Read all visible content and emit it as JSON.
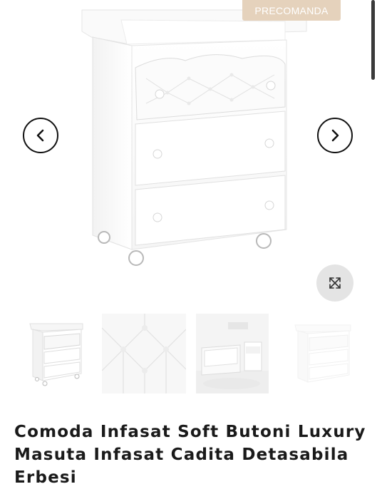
{
  "product": {
    "badge": "PRECOMANDA",
    "title": "Comoda Infasat Soft Butoni Luxury Masuta Infasat Cadita Detasabila Erbesi"
  },
  "gallery": {
    "prev_icon": "chevron-left-icon",
    "next_icon": "chevron-right-icon",
    "zoom_icon": "expand-icon",
    "thumbnails": [
      {
        "name": "thumbnail-front"
      },
      {
        "name": "thumbnail-tufted-detail"
      },
      {
        "name": "thumbnail-room"
      },
      {
        "name": "thumbnail-faded"
      }
    ]
  },
  "colors": {
    "badge_bg": "#e5d2bc",
    "badge_text": "#ffffff",
    "title_text": "#1a1a1a",
    "zoom_bg": "#e4e4e4"
  }
}
